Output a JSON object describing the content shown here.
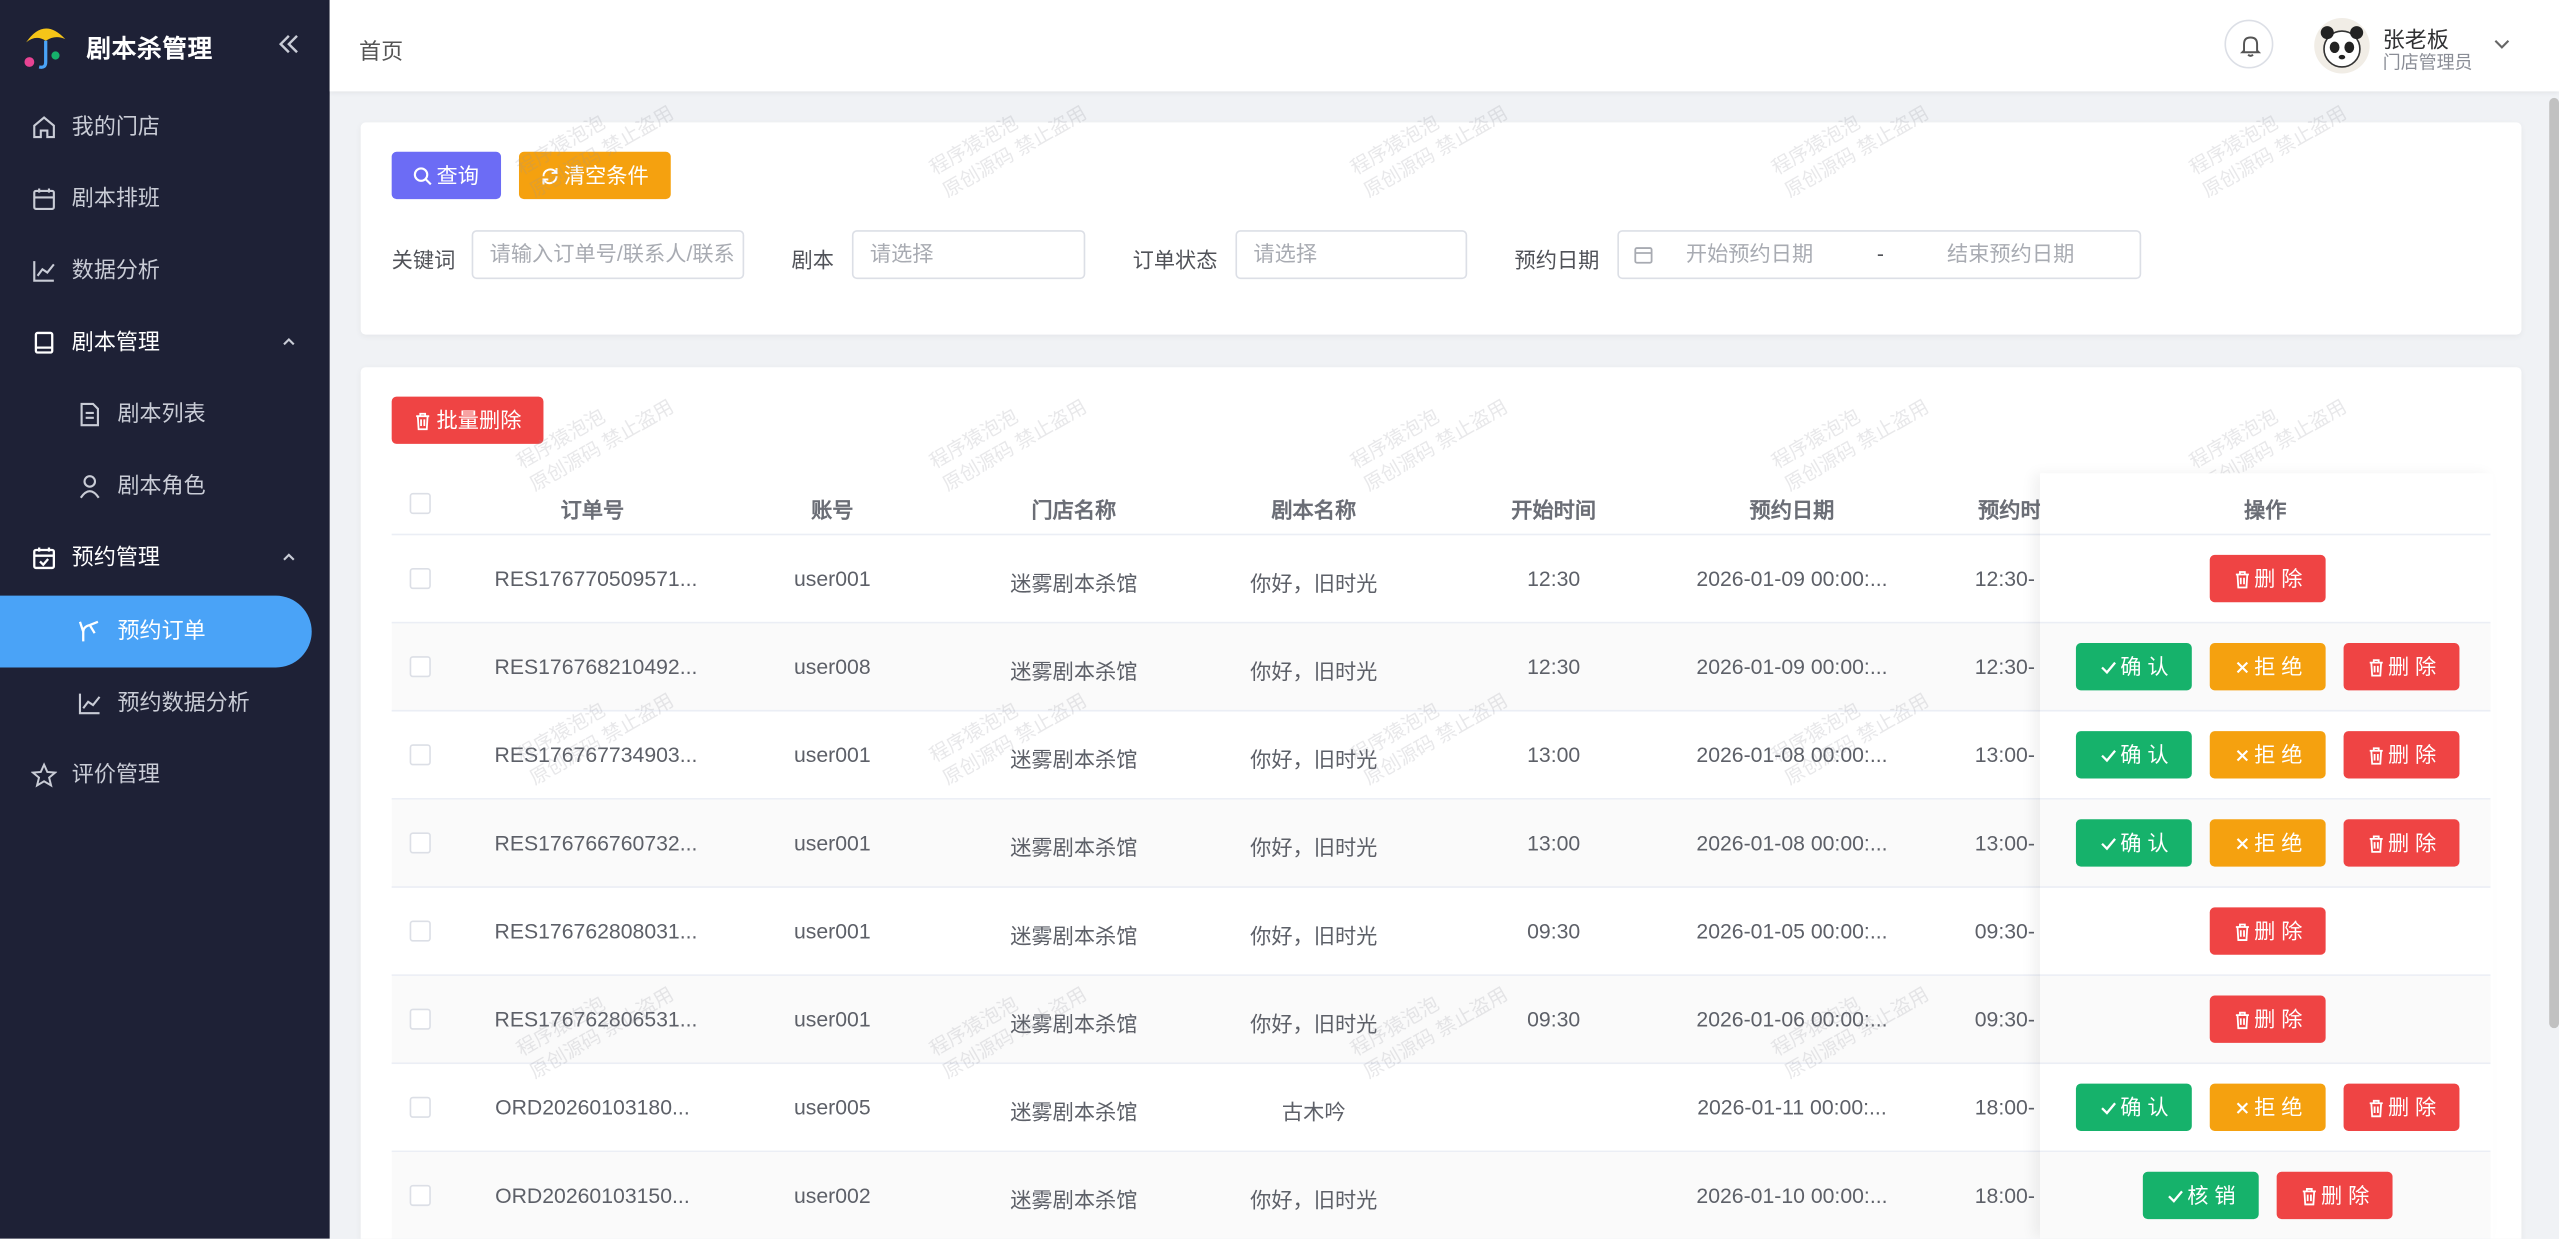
{
  "app": {
    "title": "剧本杀管理"
  },
  "sidebar": {
    "items": [
      {
        "label": "我的门店",
        "icon": "home-icon"
      },
      {
        "label": "剧本排班",
        "icon": "calendar-icon"
      },
      {
        "label": "数据分析",
        "icon": "line-chart-icon"
      },
      {
        "label": "剧本管理",
        "icon": "book-icon"
      },
      {
        "label": "剧本列表",
        "icon": "document-icon"
      },
      {
        "label": "剧本角色",
        "icon": "user-icon"
      },
      {
        "label": "预约管理",
        "icon": "calendar-check-icon"
      },
      {
        "label": "预约订单",
        "icon": "branch-icon"
      },
      {
        "label": "预约数据分析",
        "icon": "line-chart-icon"
      },
      {
        "label": "评价管理",
        "icon": "star-icon"
      }
    ],
    "active": "预约订单"
  },
  "header": {
    "breadcrumb": "首页",
    "user_name": "张老板",
    "user_role": "门店管理员"
  },
  "filters": {
    "query_label": "查询",
    "clear_label": "清空条件",
    "keyword_label": "关键词",
    "keyword_placeholder": "请输入订单号/联系人/联系",
    "script_label": "剧本",
    "script_placeholder": "请选择",
    "status_label": "订单状态",
    "status_placeholder": "请选择",
    "date_label": "预约日期",
    "date_start_placeholder": "开始预约日期",
    "date_sep": "-",
    "date_end_placeholder": "结束预约日期"
  },
  "toolbar": {
    "batch_delete_label": "批量删除"
  },
  "table": {
    "columns": [
      "订单号",
      "账号",
      "门店名称",
      "剧本名称",
      "开始时间",
      "预约日期",
      "预约时",
      "操作"
    ],
    "rows": [
      [
        "RES176770509571...",
        "user001",
        "迷雾剧本杀馆",
        "你好，旧时光",
        "12:30",
        "2026-01-09 00:00:...",
        "12:30-"
      ],
      [
        "RES176768210492...",
        "user008",
        "迷雾剧本杀馆",
        "你好，旧时光",
        "12:30",
        "2026-01-09 00:00:...",
        "12:30-"
      ],
      [
        "RES176767734903...",
        "user001",
        "迷雾剧本杀馆",
        "你好，旧时光",
        "13:00",
        "2026-01-08 00:00:...",
        "13:00-"
      ],
      [
        "RES176766760732...",
        "user001",
        "迷雾剧本杀馆",
        "你好，旧时光",
        "13:00",
        "2026-01-08 00:00:...",
        "13:00-"
      ],
      [
        "RES176762808031...",
        "user001",
        "迷雾剧本杀馆",
        "你好，旧时光",
        "09:30",
        "2026-01-05 00:00:...",
        "09:30-"
      ],
      [
        "RES176762806531...",
        "user001",
        "迷雾剧本杀馆",
        "你好，旧时光",
        "09:30",
        "2026-01-06 00:00:...",
        "09:30-"
      ],
      [
        "ORD20260103180...",
        "user005",
        "迷雾剧本杀馆",
        "古木吟",
        "",
        "2026-01-11 00:00:...",
        "18:00-"
      ],
      [
        "ORD20260103150...",
        "user002",
        "迷雾剧本杀馆",
        "你好，旧时光",
        "",
        "2026-01-10 00:00:...",
        "18:00-"
      ]
    ],
    "actions": {
      "confirm": "确 认",
      "reject": "拒 绝",
      "delete": "删 除",
      "verify": "核 销"
    }
  },
  "watermark": {
    "line1": "程序猿泡泡",
    "line2": "原创源码 禁止盗用"
  },
  "colors": {
    "sidebar_bg": "#1e2136",
    "active_bg": "#4aa3f7",
    "purple": "#6c6cf5",
    "orange": "#f5a10f",
    "red": "#ef4444",
    "green": "#16b26b"
  }
}
